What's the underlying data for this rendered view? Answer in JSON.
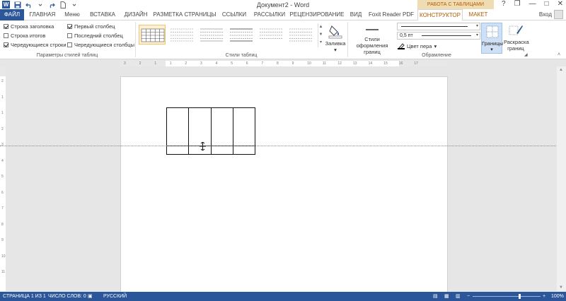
{
  "window": {
    "title": "Документ2 - Word",
    "context_group": "РАБОТА С ТАБЛИЦАМИ",
    "controls": [
      "?",
      "❐",
      "—",
      "□",
      "✕"
    ]
  },
  "tabs": [
    {
      "label": "ФАЙЛ"
    },
    {
      "label": "ГЛАВНАЯ"
    },
    {
      "label": "Меню"
    },
    {
      "label": "ВСТАВКА"
    },
    {
      "label": "ДИЗАЙН"
    },
    {
      "label": "РАЗМЕТКА СТРАНИЦЫ"
    },
    {
      "label": "ССЫЛКИ"
    },
    {
      "label": "РАССЫЛКИ"
    },
    {
      "label": "РЕЦЕНЗИРОВАНИЕ"
    },
    {
      "label": "ВИД"
    },
    {
      "label": "Foxit Reader PDF"
    },
    {
      "label": "КОНСТРУКТОР"
    },
    {
      "label": "МАКЕТ"
    }
  ],
  "user": {
    "login": "Вход"
  },
  "style_options": {
    "group_label": "Параметры стилей таблиц",
    "items": [
      {
        "label": "Строка заголовка",
        "checked": true
      },
      {
        "label": "Строка итогов",
        "checked": false
      },
      {
        "label": "Чередующиеся строки",
        "checked": true
      },
      {
        "label": "Первый столбец",
        "checked": true
      },
      {
        "label": "Последний столбец",
        "checked": false
      },
      {
        "label": "Чередующиеся столбцы",
        "checked": false
      }
    ]
  },
  "table_styles": {
    "group_label": "Стили таблиц",
    "shading_label": "Заливка",
    "shading_arrow": "▾",
    "gallery_scroll": [
      "▲",
      "▼",
      "▾"
    ]
  },
  "borders": {
    "group_label": "Обрамление",
    "border_styles_label": "Стили оформления границ",
    "line_weight": "0,5 пт",
    "pen_color_label": "Цвет пера",
    "borders_label": "Границы",
    "painter_label": "Раскраска границ"
  },
  "ruler": {
    "h_ticks": [
      "3",
      "2",
      "1",
      "1",
      "2",
      "3",
      "4",
      "5",
      "6",
      "7",
      "8",
      "9",
      "10",
      "11",
      "12",
      "13",
      "14",
      "15",
      "16",
      "17"
    ],
    "v_ticks": [
      "2",
      "1",
      "1",
      "2",
      "3",
      "4",
      "5",
      "6",
      "7",
      "8",
      "9",
      "10",
      "11"
    ]
  },
  "document": {
    "table_rows": 2,
    "table_cols": 4
  },
  "status": {
    "page": "СТРАНИЦА 1 ИЗ 1",
    "words": "ЧИСЛО СЛОВ: 0",
    "language": "РУССКИЙ",
    "zoom": "100%",
    "zoom_minus": "−",
    "zoom_plus": "+"
  },
  "colors": {
    "accent": "#2b579a",
    "context": "#b35b00"
  }
}
